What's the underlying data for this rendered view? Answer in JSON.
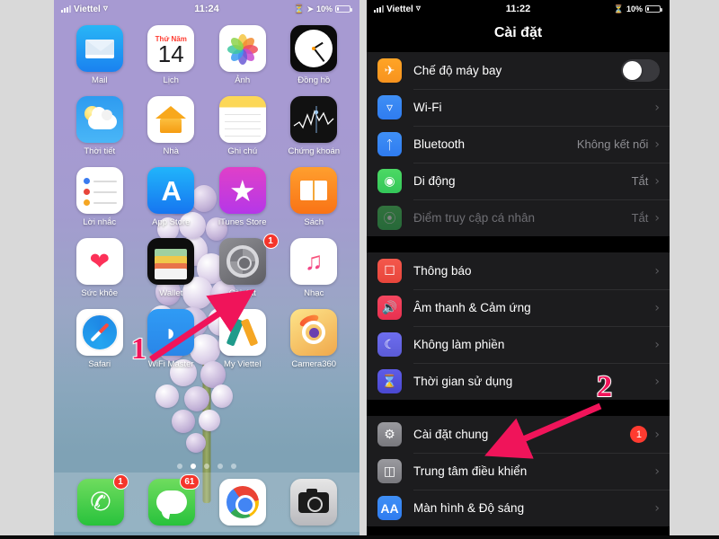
{
  "left_phone": {
    "status": {
      "carrier": "Viettel",
      "time": "11:24",
      "battery": "10%",
      "signal_icon": "cellular-signal-icon",
      "wifi_icon": "wifi-icon",
      "location_icon": "location-arrow-icon",
      "alarm_icon": "alarm-icon"
    },
    "apps": [
      {
        "label": "Mail",
        "icon": "mail-icon"
      },
      {
        "label": "Lịch",
        "icon": "calendar-icon",
        "day_name": "Thứ Năm",
        "day_num": "14"
      },
      {
        "label": "Ảnh",
        "icon": "photos-icon"
      },
      {
        "label": "Đồng hồ",
        "icon": "clock-icon"
      },
      {
        "label": "Thời tiết",
        "icon": "weather-icon"
      },
      {
        "label": "Nhà",
        "icon": "home-icon"
      },
      {
        "label": "Ghi chú",
        "icon": "notes-icon"
      },
      {
        "label": "Chứng khoán",
        "icon": "stocks-icon"
      },
      {
        "label": "Lời nhắc",
        "icon": "reminders-icon"
      },
      {
        "label": "App Store",
        "icon": "app-store-icon"
      },
      {
        "label": "iTunes Store",
        "icon": "itunes-store-icon"
      },
      {
        "label": "Sách",
        "icon": "books-icon"
      },
      {
        "label": "Sức khỏe",
        "icon": "health-icon"
      },
      {
        "label": "Wallet",
        "icon": "wallet-icon"
      },
      {
        "label": "Cài đặt",
        "icon": "settings-gear-icon",
        "badge": "1"
      },
      {
        "label": "Nhạc",
        "icon": "music-icon"
      },
      {
        "label": "Safari",
        "icon": "safari-compass-icon"
      },
      {
        "label": "WiFi Master",
        "icon": "wifi-master-icon"
      },
      {
        "label": "My Viettel",
        "icon": "my-viettel-icon"
      },
      {
        "label": "Camera360",
        "icon": "camera360-icon"
      }
    ],
    "page_dots": {
      "count": 5,
      "active_index": 1
    },
    "dock": [
      {
        "label": "Điện thoại",
        "icon": "phone-icon",
        "badge": "1"
      },
      {
        "label": "Tin nhắn",
        "icon": "messages-icon",
        "badge": "61"
      },
      {
        "label": "Chrome",
        "icon": "chrome-icon"
      },
      {
        "label": "Camera",
        "icon": "camera-icon"
      }
    ]
  },
  "right_phone": {
    "status": {
      "carrier": "Viettel",
      "time": "11:22",
      "battery": "10%"
    },
    "nav_title": "Cài đặt",
    "groups": [
      {
        "rows": [
          {
            "label": "Chế độ máy bay",
            "icon": "airplane-icon",
            "control": "toggle",
            "toggle_on": false
          },
          {
            "label": "Wi-Fi",
            "icon": "wifi-icon",
            "value": "",
            "control": "chevron"
          },
          {
            "label": "Bluetooth",
            "icon": "bluetooth-icon",
            "value": "Không kết nối",
            "control": "chevron"
          },
          {
            "label": "Di động",
            "icon": "cellular-icon",
            "value": "Tắt",
            "control": "chevron"
          },
          {
            "label": "Điểm truy cập cá nhân",
            "icon": "hotspot-icon",
            "value": "Tắt",
            "control": "chevron",
            "dimmed": true
          }
        ]
      },
      {
        "rows": [
          {
            "label": "Thông báo",
            "icon": "notifications-icon",
            "control": "chevron"
          },
          {
            "label": "Âm thanh & Cảm ứng",
            "icon": "sound-haptics-icon",
            "control": "chevron"
          },
          {
            "label": "Không làm phiền",
            "icon": "do-not-disturb-moon-icon",
            "control": "chevron"
          },
          {
            "label": "Thời gian sử dụng",
            "icon": "screen-time-hourglass-icon",
            "control": "chevron"
          }
        ]
      },
      {
        "rows": [
          {
            "label": "Cài đặt chung",
            "icon": "general-gear-icon",
            "badge": "1",
            "control": "chevron"
          },
          {
            "label": "Trung tâm điều khiển",
            "icon": "control-center-icon",
            "control": "chevron"
          },
          {
            "label": "Màn hình & Độ sáng",
            "icon": "display-brightness-icon",
            "icon_text": "AA",
            "control": "chevron"
          }
        ]
      }
    ]
  },
  "annotations": [
    {
      "label": "1",
      "target": "settings-app-icon"
    },
    {
      "label": "2",
      "target": "general-settings-row"
    }
  ],
  "colors": {
    "annotation": "#f0145a",
    "badge_red": "#ff3b30",
    "ios_group_bg": "#1c1c1e",
    "page_bg": "#d9d9d9"
  }
}
